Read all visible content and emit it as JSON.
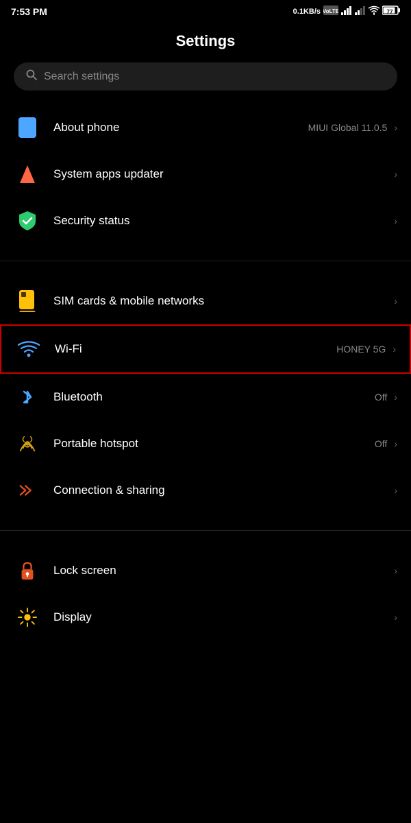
{
  "statusBar": {
    "time": "7:53 PM",
    "dataSpeed": "0.1KB/s",
    "networkType": "VoLTE",
    "batteryLevel": "77"
  },
  "pageTitle": "Settings",
  "searchBar": {
    "placeholder": "Search settings"
  },
  "sections": [
    {
      "items": [
        {
          "id": "about-phone",
          "label": "About phone",
          "value": "MIUI Global 11.0.5",
          "icon": "phone-icon",
          "hasChevron": true
        },
        {
          "id": "system-apps-updater",
          "label": "System apps updater",
          "value": "",
          "icon": "arrow-up-icon",
          "hasChevron": true
        },
        {
          "id": "security-status",
          "label": "Security status",
          "value": "",
          "icon": "shield-icon",
          "hasChevron": true
        }
      ]
    },
    {
      "items": [
        {
          "id": "sim-cards",
          "label": "SIM cards & mobile networks",
          "value": "",
          "icon": "sim-icon",
          "hasChevron": true
        },
        {
          "id": "wifi",
          "label": "Wi-Fi",
          "value": "HONEY 5G",
          "icon": "wifi-icon",
          "hasChevron": true,
          "highlighted": true
        },
        {
          "id": "bluetooth",
          "label": "Bluetooth",
          "value": "Off",
          "icon": "bluetooth-icon",
          "hasChevron": true
        },
        {
          "id": "hotspot",
          "label": "Portable hotspot",
          "value": "Off",
          "icon": "hotspot-icon",
          "hasChevron": true
        },
        {
          "id": "connection-sharing",
          "label": "Connection & sharing",
          "value": "",
          "icon": "connection-icon",
          "hasChevron": true
        }
      ]
    },
    {
      "items": [
        {
          "id": "lock-screen",
          "label": "Lock screen",
          "value": "",
          "icon": "lock-icon",
          "hasChevron": true
        },
        {
          "id": "display",
          "label": "Display",
          "value": "",
          "icon": "display-icon",
          "hasChevron": true
        }
      ]
    }
  ],
  "chevron": "›"
}
